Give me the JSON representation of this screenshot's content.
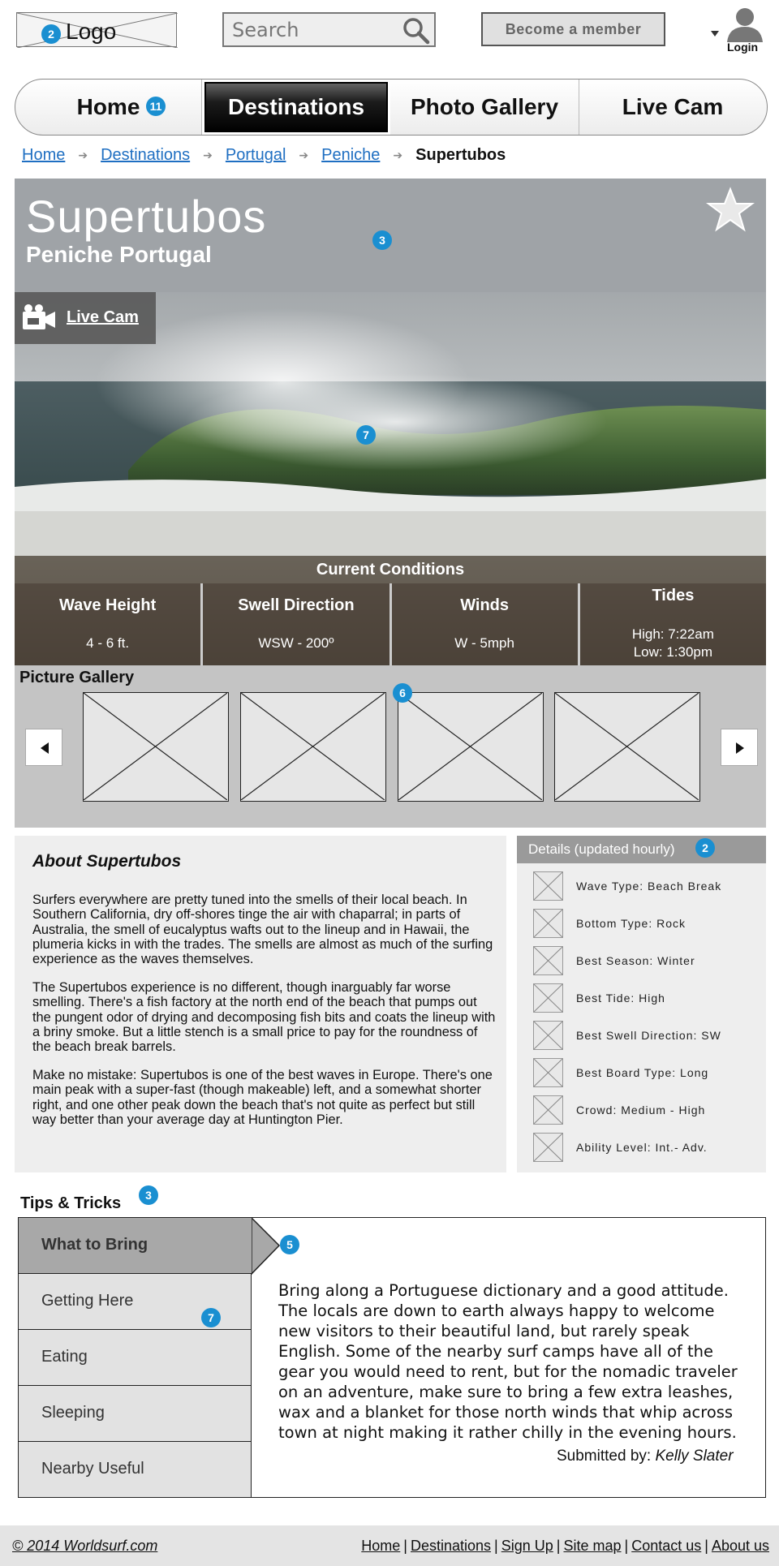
{
  "header": {
    "logo_text": "Logo",
    "search_placeholder": "Search",
    "member_button": "Become a member",
    "login_label": "Login"
  },
  "nav": {
    "tabs": [
      {
        "label": "Home",
        "active": false
      },
      {
        "label": "Destinations",
        "active": true
      },
      {
        "label": "Photo Gallery",
        "active": false
      },
      {
        "label": "Live Cam",
        "active": false
      }
    ]
  },
  "breadcrumb": {
    "items": [
      "Home",
      "Destinations",
      "Portugal",
      "Peniche"
    ],
    "current": "Supertubos"
  },
  "hero": {
    "title": "Supertubos",
    "subtitle": "Peniche Portugal",
    "livecam_label": "Live Cam"
  },
  "conditions": {
    "heading": "Current Conditions",
    "items": [
      {
        "label": "Wave Height",
        "value": "4 - 6 ft."
      },
      {
        "label": "Swell Direction",
        "value": "WSW - 200º"
      },
      {
        "label": "Winds",
        "value": "W - 5mph"
      },
      {
        "label": "Tides",
        "value": "High: 7:22am",
        "value2": "Low: 1:30pm"
      }
    ]
  },
  "gallery": {
    "title": "Picture Gallery"
  },
  "about": {
    "title": "About Supertubos",
    "paragraphs": [
      "Surfers everywhere are pretty tuned into the smells of their local beach. In Southern California, dry off-shores tinge the air with chaparral; in parts of Australia, the smell of eucalyptus wafts out to the lineup and in Hawaii, the plumeria kicks in with the trades. The smells are almost as much of the surfing experience as the waves themselves.",
      "The Supertubos experience is no different, though inarguably far worse smelling. There's a fish factory at the north end of the beach that pumps out the pungent odor of drying and decomposing fish bits and coats the lineup with a briny smoke. But a little stench is a small price to pay for the roundness of the beach break barrels.",
      "Make no mistake: Supertubos is one of the best waves in Europe. There's one main peak with a super-fast (though makeable) left, and a somewhat shorter right, and one other peak down the beach that's not quite as perfect but still way better than your average day at Huntington Pier."
    ]
  },
  "details": {
    "heading": "Details (updated hourly)",
    "items": [
      "Wave Type: Beach Break",
      "Bottom Type: Rock",
      "Best Season: Winter",
      "Best Tide: High",
      "Best Swell Direction:  SW",
      "Best Board Type: Long",
      "Crowd: Medium - High",
      "Ability Level: Int.- Adv."
    ]
  },
  "tips": {
    "title": "Tips & Tricks",
    "tabs": [
      "What to Bring",
      "Getting Here",
      "Eating",
      "Sleeping",
      "Nearby Useful"
    ],
    "active_tab": "What to Bring",
    "text": "Bring along a Portuguese  dictionary and a good attitude. The locals are down to earth always happy to welcome new visitors to their beautiful land, but rarely speak English. Some of the nearby surf camps have all of the gear you would need to rent, but for the nomadic traveler on an adventure, make sure to  bring a few extra leashes, wax and a blanket for those north winds that whip across town at night making it rather chilly in the evening hours.",
    "submitted_prefix": "Submitted by:",
    "submitted_by": "Kelly Slater"
  },
  "footer": {
    "copyright": "© 2014 Worldsurf.com",
    "links": [
      "Home",
      "Destinations",
      "Sign Up",
      "Site map",
      "Contact us",
      "About us"
    ]
  },
  "annotations": {
    "logo": "2",
    "nav_home": "11",
    "hero_title": "3",
    "hero_image": "7",
    "gallery": "6",
    "details": "2",
    "tips_title": "3",
    "tips_active": "5",
    "tips_tab": "7"
  },
  "colors": {
    "link": "#1f6fc2",
    "badge": "#1a8fd1",
    "panel": "#eeeeee",
    "gallery_bg": "#c4c4c4",
    "details_head": "#9a9a9a"
  },
  "icons": [
    "search-icon",
    "user-icon",
    "star-icon",
    "video-camera-icon",
    "arrow-left-icon",
    "arrow-right-icon",
    "breadcrumb-arrow-icon"
  ]
}
